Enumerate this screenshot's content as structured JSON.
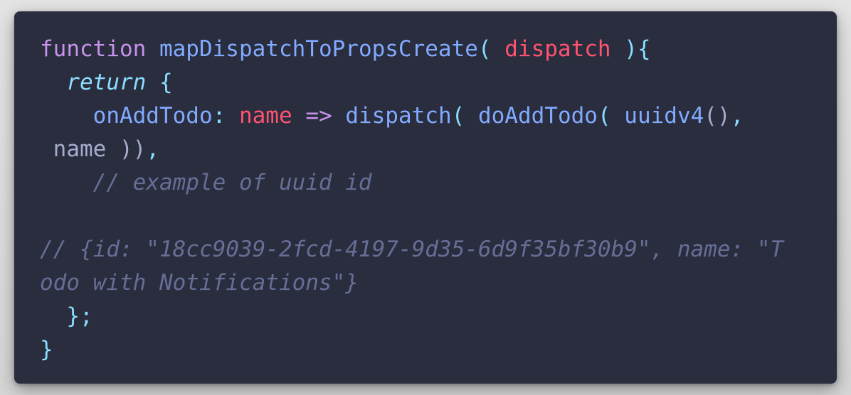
{
  "code": {
    "line1": {
      "kw_function": "function",
      "fn_name": "mapDispatchToPropsCreate",
      "open_paren": "(",
      "param": "dispatch",
      "close_paren_brace": "){"
    },
    "line2": {
      "kw_return": "return",
      "open_brace": "{"
    },
    "line3": {
      "prop": "onAddTodo",
      "colon": ":",
      "param_name": "name",
      "arrow": "=>",
      "dispatch_call": "dispatch",
      "paren1": "(",
      "action": "doAddTodo",
      "paren2": "(",
      "uuid_fn": "uuidv4",
      "call_parens": "()",
      "comma": ","
    },
    "line4": {
      "name_arg": "name",
      "close": "))",
      "comma": ","
    },
    "line5": {
      "comment": "// example of uuid id"
    },
    "line7": {
      "comment": "// {id: \"18cc9039-2fcd-4197-9d35-6d9f35bf30b9\", name: \"T"
    },
    "line8": {
      "comment": "odo with Notifications\"}"
    },
    "line9": {
      "close": "};"
    },
    "line10": {
      "close": "}"
    }
  },
  "colors": {
    "background": "#292d3e",
    "keyword": "#c792ea",
    "function": "#82aaff",
    "parameter": "#ff5370",
    "punctuation": "#89ddff",
    "comment": "#676e95",
    "text": "#a6accd"
  }
}
